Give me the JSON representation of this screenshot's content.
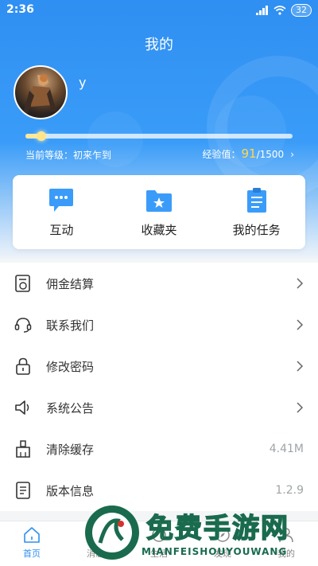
{
  "status_bar": {
    "time": "2:36",
    "battery": "32"
  },
  "header": {
    "title": "我的"
  },
  "profile": {
    "username": "y"
  },
  "level": {
    "label": "当前等级：初来乍到",
    "exp_prefix": "经验值：",
    "exp_current": "91",
    "exp_max": "/1500",
    "progress": 0.06
  },
  "quick_actions": [
    {
      "label": "互动",
      "icon": "chat-bubble-icon"
    },
    {
      "label": "收藏夹",
      "icon": "folder-star-icon"
    },
    {
      "label": "我的任务",
      "icon": "clipboard-icon"
    }
  ],
  "menu": [
    {
      "label": "佣金结算",
      "icon": "bill-icon",
      "value": ""
    },
    {
      "label": "联系我们",
      "icon": "headset-icon",
      "value": ""
    },
    {
      "label": "修改密码",
      "icon": "lock-icon",
      "value": ""
    },
    {
      "label": "系统公告",
      "icon": "speaker-icon",
      "value": ""
    },
    {
      "label": "清除缓存",
      "icon": "broom-icon",
      "value": "4.41M"
    },
    {
      "label": "版本信息",
      "icon": "document-icon",
      "value": "1.2.9"
    }
  ],
  "tabbar": [
    {
      "label": "首页",
      "icon": "home-icon"
    },
    {
      "label": "消息",
      "icon": "message-icon"
    },
    {
      "label": "生活",
      "icon": "life-icon"
    },
    {
      "label": "发现",
      "icon": "discover-icon"
    },
    {
      "label": "我的",
      "icon": "profile-icon"
    }
  ],
  "watermark": {
    "title": "免费手游网",
    "subtitle": "MIANFEISHOUYOUWANG"
  },
  "colors": {
    "primary": "#2f8ff2",
    "accent": "#ffd84d",
    "icon_blue": "#3a9cf8"
  }
}
